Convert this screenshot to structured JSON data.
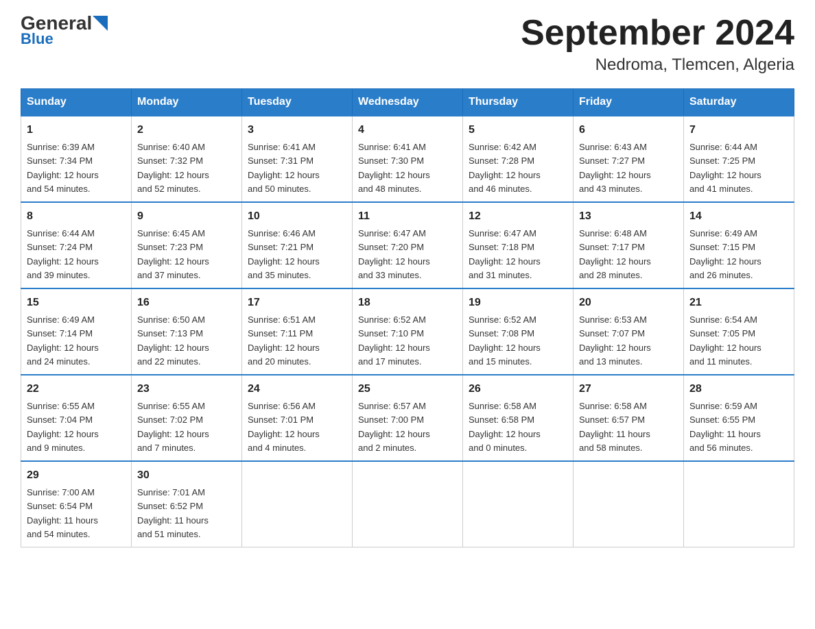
{
  "header": {
    "logo_general": "General",
    "logo_blue": "Blue",
    "title": "September 2024",
    "subtitle": "Nedroma, Tlemcen, Algeria"
  },
  "weekdays": [
    "Sunday",
    "Monday",
    "Tuesday",
    "Wednesday",
    "Thursday",
    "Friday",
    "Saturday"
  ],
  "weeks": [
    [
      {
        "day": "1",
        "sunrise": "6:39 AM",
        "sunset": "7:34 PM",
        "daylight": "12 hours and 54 minutes."
      },
      {
        "day": "2",
        "sunrise": "6:40 AM",
        "sunset": "7:32 PM",
        "daylight": "12 hours and 52 minutes."
      },
      {
        "day": "3",
        "sunrise": "6:41 AM",
        "sunset": "7:31 PM",
        "daylight": "12 hours and 50 minutes."
      },
      {
        "day": "4",
        "sunrise": "6:41 AM",
        "sunset": "7:30 PM",
        "daylight": "12 hours and 48 minutes."
      },
      {
        "day": "5",
        "sunrise": "6:42 AM",
        "sunset": "7:28 PM",
        "daylight": "12 hours and 46 minutes."
      },
      {
        "day": "6",
        "sunrise": "6:43 AM",
        "sunset": "7:27 PM",
        "daylight": "12 hours and 43 minutes."
      },
      {
        "day": "7",
        "sunrise": "6:44 AM",
        "sunset": "7:25 PM",
        "daylight": "12 hours and 41 minutes."
      }
    ],
    [
      {
        "day": "8",
        "sunrise": "6:44 AM",
        "sunset": "7:24 PM",
        "daylight": "12 hours and 39 minutes."
      },
      {
        "day": "9",
        "sunrise": "6:45 AM",
        "sunset": "7:23 PM",
        "daylight": "12 hours and 37 minutes."
      },
      {
        "day": "10",
        "sunrise": "6:46 AM",
        "sunset": "7:21 PM",
        "daylight": "12 hours and 35 minutes."
      },
      {
        "day": "11",
        "sunrise": "6:47 AM",
        "sunset": "7:20 PM",
        "daylight": "12 hours and 33 minutes."
      },
      {
        "day": "12",
        "sunrise": "6:47 AM",
        "sunset": "7:18 PM",
        "daylight": "12 hours and 31 minutes."
      },
      {
        "day": "13",
        "sunrise": "6:48 AM",
        "sunset": "7:17 PM",
        "daylight": "12 hours and 28 minutes."
      },
      {
        "day": "14",
        "sunrise": "6:49 AM",
        "sunset": "7:15 PM",
        "daylight": "12 hours and 26 minutes."
      }
    ],
    [
      {
        "day": "15",
        "sunrise": "6:49 AM",
        "sunset": "7:14 PM",
        "daylight": "12 hours and 24 minutes."
      },
      {
        "day": "16",
        "sunrise": "6:50 AM",
        "sunset": "7:13 PM",
        "daylight": "12 hours and 22 minutes."
      },
      {
        "day": "17",
        "sunrise": "6:51 AM",
        "sunset": "7:11 PM",
        "daylight": "12 hours and 20 minutes."
      },
      {
        "day": "18",
        "sunrise": "6:52 AM",
        "sunset": "7:10 PM",
        "daylight": "12 hours and 17 minutes."
      },
      {
        "day": "19",
        "sunrise": "6:52 AM",
        "sunset": "7:08 PM",
        "daylight": "12 hours and 15 minutes."
      },
      {
        "day": "20",
        "sunrise": "6:53 AM",
        "sunset": "7:07 PM",
        "daylight": "12 hours and 13 minutes."
      },
      {
        "day": "21",
        "sunrise": "6:54 AM",
        "sunset": "7:05 PM",
        "daylight": "12 hours and 11 minutes."
      }
    ],
    [
      {
        "day": "22",
        "sunrise": "6:55 AM",
        "sunset": "7:04 PM",
        "daylight": "12 hours and 9 minutes."
      },
      {
        "day": "23",
        "sunrise": "6:55 AM",
        "sunset": "7:02 PM",
        "daylight": "12 hours and 7 minutes."
      },
      {
        "day": "24",
        "sunrise": "6:56 AM",
        "sunset": "7:01 PM",
        "daylight": "12 hours and 4 minutes."
      },
      {
        "day": "25",
        "sunrise": "6:57 AM",
        "sunset": "7:00 PM",
        "daylight": "12 hours and 2 minutes."
      },
      {
        "day": "26",
        "sunrise": "6:58 AM",
        "sunset": "6:58 PM",
        "daylight": "12 hours and 0 minutes."
      },
      {
        "day": "27",
        "sunrise": "6:58 AM",
        "sunset": "6:57 PM",
        "daylight": "11 hours and 58 minutes."
      },
      {
        "day": "28",
        "sunrise": "6:59 AM",
        "sunset": "6:55 PM",
        "daylight": "11 hours and 56 minutes."
      }
    ],
    [
      {
        "day": "29",
        "sunrise": "7:00 AM",
        "sunset": "6:54 PM",
        "daylight": "11 hours and 54 minutes."
      },
      {
        "day": "30",
        "sunrise": "7:01 AM",
        "sunset": "6:52 PM",
        "daylight": "11 hours and 51 minutes."
      },
      null,
      null,
      null,
      null,
      null
    ]
  ],
  "labels": {
    "sunrise": "Sunrise:",
    "sunset": "Sunset:",
    "daylight": "Daylight:"
  }
}
